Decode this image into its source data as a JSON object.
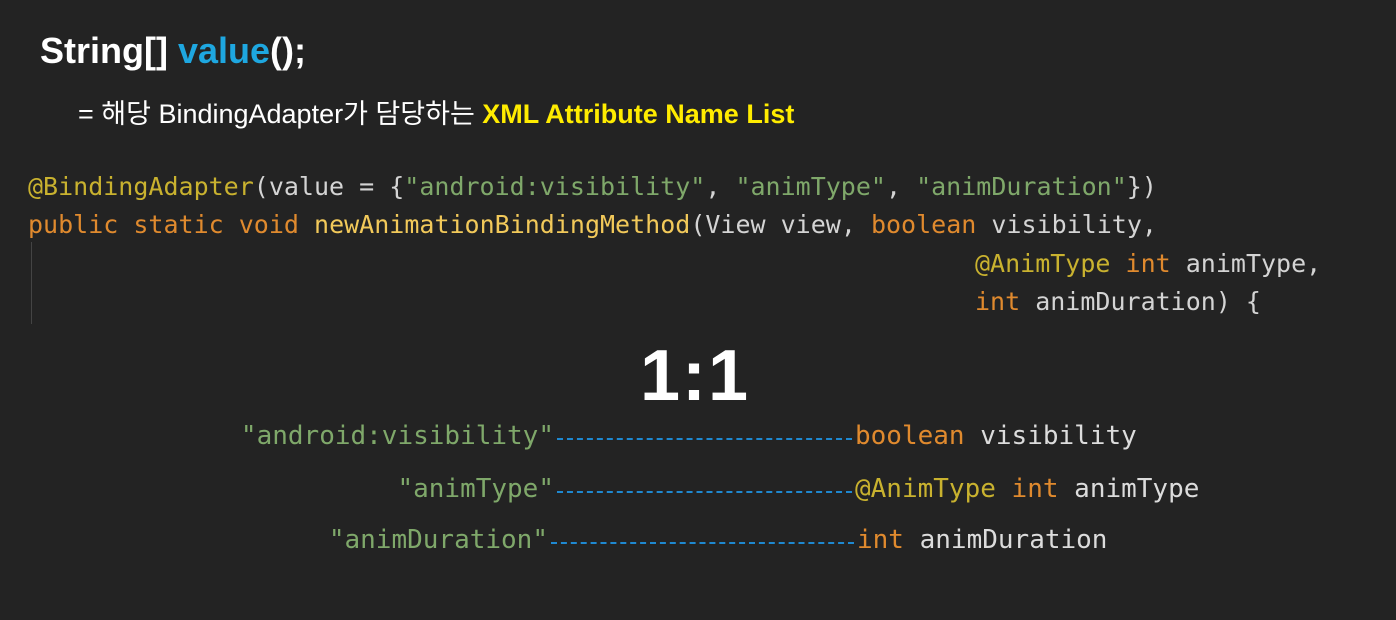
{
  "heading": {
    "type": "String[]",
    "method": "value",
    "suffix": "();"
  },
  "subtitle": {
    "prefix": "= 해당 BindingAdapter가 담당하는 ",
    "highlight": "XML Attribute Name List"
  },
  "code": {
    "line1": {
      "annotation": "@BindingAdapter",
      "open": "(value = {",
      "str1": "\"android:visibility\"",
      "sep1": ", ",
      "str2": "\"animType\"",
      "sep2": ", ",
      "str3": "\"animDuration\"",
      "close": "})"
    },
    "line2": {
      "kw_public": "public",
      "kw_static": "static",
      "kw_void": "void",
      "method_name": "newAnimationBindingMethod",
      "params_open": "(View view, ",
      "kw_boolean": "boolean",
      "param1_rest": " visibility,"
    },
    "line3": {
      "annotation": "@AnimType",
      "kw_int": "int",
      "param_rest": " animType,"
    },
    "line4": {
      "kw_int": "int",
      "param_rest": " animDuration) {"
    }
  },
  "ratio": "1:1",
  "mapping": [
    {
      "attr": "\"android:visibility\"",
      "annotation": "",
      "type": "boolean",
      "name": " visibility"
    },
    {
      "attr": "\"animType\"",
      "annotation": "@AnimType",
      "type": "int",
      "name": " animType"
    },
    {
      "attr": "\"animDuration\"",
      "annotation": "",
      "type": "int",
      "name": " animDuration"
    }
  ],
  "colors": {
    "background": "#232323",
    "keyword_blue": "#1ea7e0",
    "highlight_yellow": "#ffec00",
    "java_keyword": "#e08a2e",
    "java_annotation": "#c9b22f",
    "java_string": "#7fa86a",
    "dash_line": "#1e88d0"
  }
}
